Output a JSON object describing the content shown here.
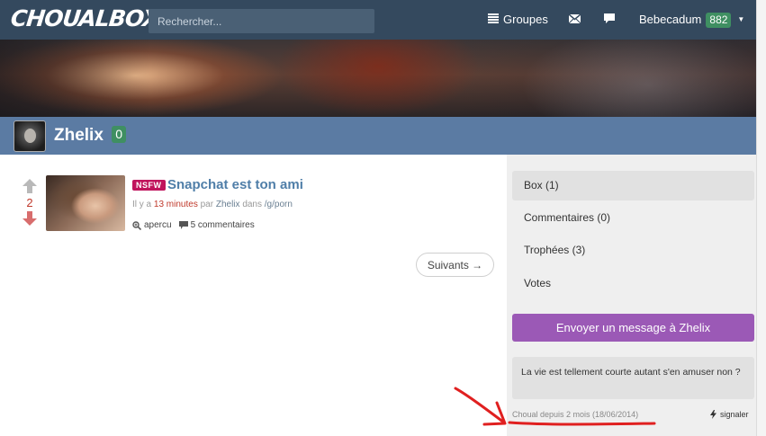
{
  "header": {
    "logo": "CHOUALBOX",
    "search_placeholder": "Rechercher...",
    "groups_label": "Groupes",
    "username": "Bebecadum",
    "points": "882"
  },
  "profile": {
    "name": "Zhelix",
    "score": "0"
  },
  "post": {
    "votes": "2",
    "tag": "NSFW",
    "title": "Snapchat est ton ami",
    "meta_prefix": "Il y a",
    "time": "13 minutes",
    "meta_by": "par",
    "user": "Zhelix",
    "meta_in": "dans",
    "group": "/g/porn",
    "preview_label": "apercu",
    "comments_label": "5 commentaires"
  },
  "pagination": {
    "next_label": "Suivants →"
  },
  "sidebar": {
    "tabs": [
      {
        "label": "Box (1)",
        "active": true
      },
      {
        "label": "Commentaires (0)",
        "active": false
      },
      {
        "label": "Trophées (3)",
        "active": false
      },
      {
        "label": "Votes",
        "active": false
      }
    ],
    "message_button": "Envoyer un message à Zhelix",
    "bio": "La vie est tellement courte autant s'en amuser non ?",
    "member_since": "Choual depuis 2 mois (18/06/2014)",
    "report_label": "signaler"
  },
  "colors": {
    "navbar": "#34495e",
    "profile_bar": "#5b7ba3",
    "accent_purple": "#9b59b6",
    "badge_green": "#3f8f62",
    "nsfw": "#c0145c",
    "annotation_red": "#e02020"
  }
}
